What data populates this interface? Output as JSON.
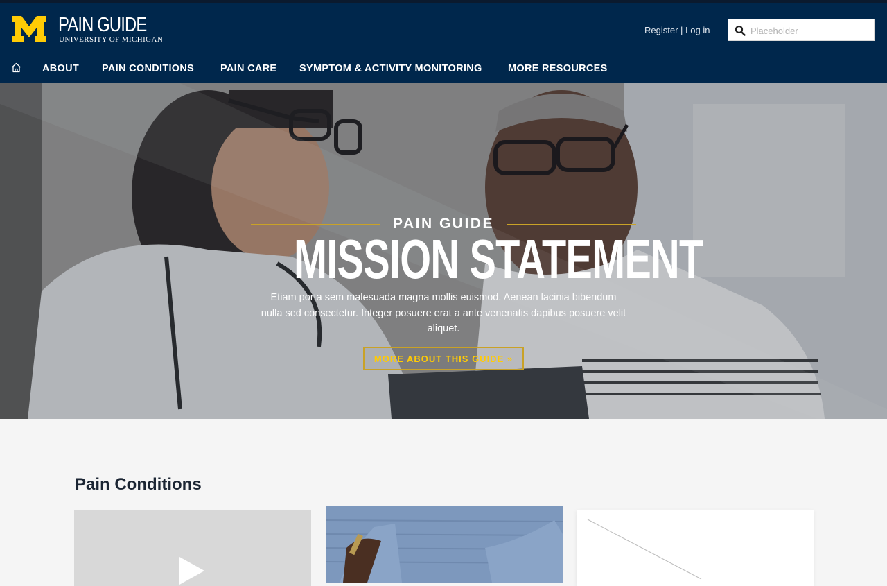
{
  "header": {
    "logo_title": "PAIN GUIDE",
    "logo_subtitle": "UNIVERSITY OF MICHIGAN",
    "register_label": "Register",
    "auth_separator": "|",
    "login_label": "Log in",
    "search_placeholder": "Placeholder",
    "colors": {
      "navy": "#00274c",
      "maize": "#ffcb05"
    }
  },
  "nav": {
    "home_icon": "home-icon",
    "items": [
      {
        "label": "ABOUT"
      },
      {
        "label": "PAIN CONDITIONS"
      },
      {
        "label": "PAIN CARE"
      },
      {
        "label": "SYMPTOM & ACTIVITY MONITORING"
      },
      {
        "label": "MORE RESOURCES"
      }
    ]
  },
  "hero": {
    "kicker": "PAIN GUIDE",
    "title": "MISSION STATEMENT",
    "description": "Etiam porta sem malesuada magna mollis euismod. Aenean lacinia bibendum nulla sed consectetur. Integer posuere erat a ante venenatis dapibus posuere velit aliquet.",
    "button_label": "MORE ABOUT THIS GUIDE »"
  },
  "main": {
    "section_title": "Pain Conditions",
    "cards": [
      {
        "type": "video",
        "icon": "play-icon"
      },
      {
        "type": "image"
      },
      {
        "type": "placeholder"
      }
    ]
  }
}
